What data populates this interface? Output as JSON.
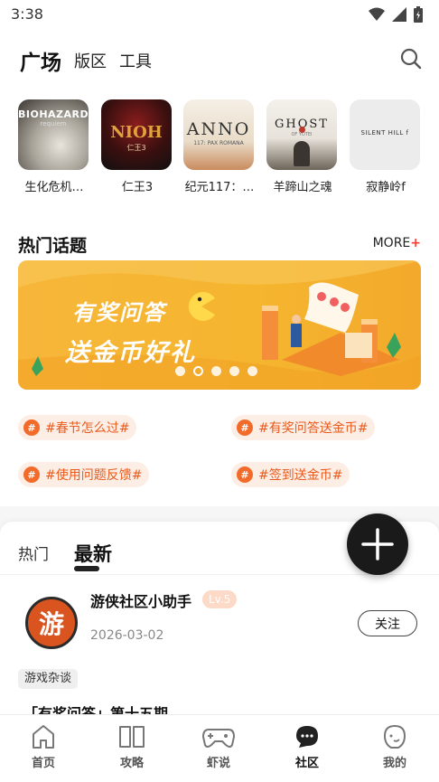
{
  "status": {
    "time": "3:38"
  },
  "header": {
    "tabs": [
      "广场",
      "版区",
      "工具"
    ]
  },
  "games": [
    {
      "cover_text": "BIOHAZARD",
      "cover_sub": "requiem",
      "name": "生化危机…"
    },
    {
      "cover_text": "NIOH",
      "cover_sub": "仁王3",
      "name": "仁王3"
    },
    {
      "cover_text": "ANNO",
      "cover_sub": "117: PAX ROMANA",
      "name": "纪元117：…"
    },
    {
      "cover_text": "GHOST",
      "cover_sub": "OF YŌTEI",
      "name": "羊蹄山之魂"
    },
    {
      "cover_text": "SILENT HILL f",
      "cover_sub": "",
      "name": "寂静岭f"
    }
  ],
  "hot_topics": {
    "title": "热门话题",
    "more_label": "MORE",
    "more_plus": "+",
    "banner": {
      "line1": "有奖问答",
      "line2": "送金币好礼",
      "dot_count": 5,
      "active_dot": 1
    },
    "tags": [
      "#春节怎么过#",
      "#有奖问答送金币#",
      "#使用问题反馈#",
      "#签到送金币#"
    ],
    "tag_icon": "#"
  },
  "feed": {
    "tabs": [
      "热门",
      "最新"
    ],
    "active_tab": 1,
    "post": {
      "author": "游侠社区小助手",
      "avatar_char": "游",
      "level": "Lv.5",
      "date": "2026-03-02",
      "follow_label": "关注",
      "category": "游戏杂谈",
      "title": "「有奖问答」第十五期"
    }
  },
  "bottom_nav": [
    {
      "label": "首页",
      "icon": "home-icon"
    },
    {
      "label": "攻略",
      "icon": "book-icon"
    },
    {
      "label": "虾说",
      "icon": "gamepad-icon"
    },
    {
      "label": "社区",
      "icon": "chat-bubble-icon"
    },
    {
      "label": "我的",
      "icon": "profile-icon"
    }
  ],
  "active_nav": 3,
  "colors": {
    "accent": "#e95a1c",
    "banner": "#f7b63a",
    "fab": "#1a1a1a"
  }
}
